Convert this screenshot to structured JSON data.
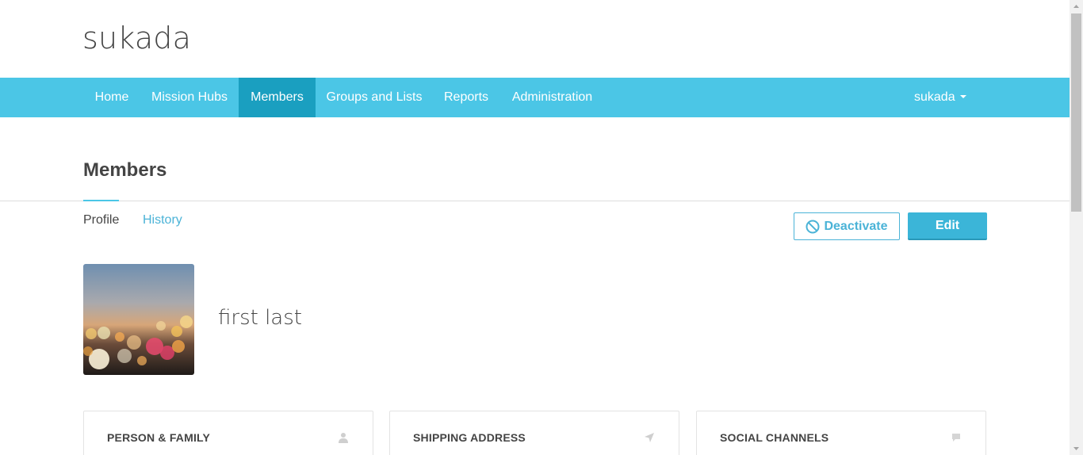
{
  "header": {
    "org_name": "sukada"
  },
  "nav": {
    "items": [
      {
        "label": "Home"
      },
      {
        "label": "Mission Hubs"
      },
      {
        "label": "Members",
        "active": true
      },
      {
        "label": "Groups and Lists"
      },
      {
        "label": "Reports"
      },
      {
        "label": "Administration"
      }
    ],
    "user_label": "sukada",
    "color": "#4bc6e6",
    "active_color": "#1a9fc0"
  },
  "page": {
    "title": "Members",
    "tabs": [
      {
        "label": "Profile",
        "active": true
      },
      {
        "label": "History"
      }
    ],
    "actions": {
      "deactivate_label": "Deactivate",
      "edit_label": "Edit"
    }
  },
  "member": {
    "name": "first last",
    "avatar_icon": "bokeh-city-lights-photo"
  },
  "cards": [
    {
      "title": "PERSON & FAMILY",
      "icon": "person-icon"
    },
    {
      "title": "SHIPPING ADDRESS",
      "icon": "location-arrow-icon"
    },
    {
      "title": "SOCIAL CHANNELS",
      "icon": "chat-bubble-icon"
    }
  ],
  "colors": {
    "accent": "#4bb3d7",
    "text": "#444444"
  }
}
